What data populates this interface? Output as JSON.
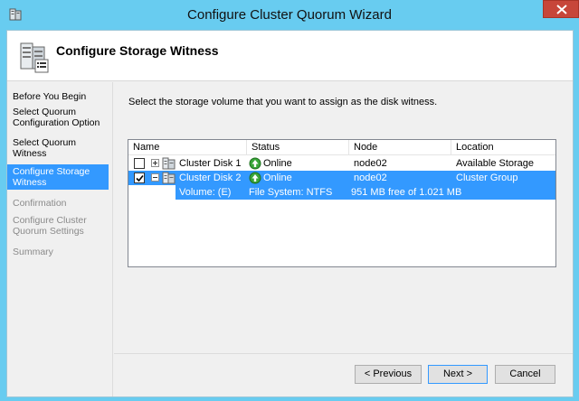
{
  "window": {
    "title": "Configure Cluster Quorum Wizard"
  },
  "header": {
    "title": "Configure Storage Witness"
  },
  "sidebar": {
    "steps": [
      {
        "label": "Before You Begin",
        "state": "normal"
      },
      {
        "label": "Select Quorum Configuration Option",
        "state": "normal"
      },
      {
        "label": "Select Quorum Witness",
        "state": "normal"
      },
      {
        "label": "Configure Storage Witness",
        "state": "current"
      },
      {
        "label": "Confirmation",
        "state": "disabled"
      },
      {
        "label": "Configure Cluster Quorum Settings",
        "state": "disabled"
      },
      {
        "label": "Summary",
        "state": "disabled"
      }
    ]
  },
  "main": {
    "instruction": "Select the storage volume that you want to assign as the disk witness.",
    "table": {
      "columns": [
        "Name",
        "Status",
        "Node",
        "Location"
      ],
      "rows": [
        {
          "checked": false,
          "expanded": false,
          "name": "Cluster Disk 1",
          "status": "Online",
          "node": "node02",
          "location": "Available Storage",
          "selected": false
        },
        {
          "checked": true,
          "expanded": true,
          "name": "Cluster Disk 2",
          "status": "Online",
          "node": "node02",
          "location": "Cluster Group",
          "selected": true
        }
      ],
      "subrow": {
        "volume": "Volume: (E)",
        "filesystem": "File System: NTFS",
        "free": "951 MB free of 1.021 MB"
      }
    }
  },
  "buttons": {
    "previous": "< Previous",
    "next": "Next >",
    "cancel": "Cancel"
  },
  "colors": {
    "titlebar": "#68ccf0",
    "selection": "#3399ff",
    "close": "#c7463a",
    "online": "#3aa63a"
  }
}
